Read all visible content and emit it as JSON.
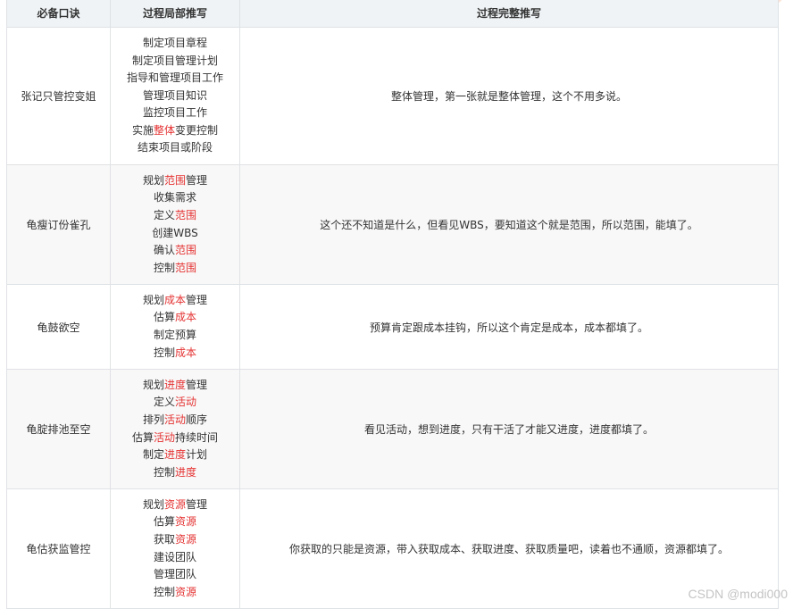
{
  "header": {
    "col1": "必备口诀",
    "col2": "过程局部推写",
    "col3": "过程完整推写"
  },
  "rows": [
    {
      "mnemonic": "张记只管控变姐",
      "processes": [
        [
          "制定项目章程"
        ],
        [
          "制定项目管理计划"
        ],
        [
          "指导和管理项目工作"
        ],
        [
          "管理项目知识"
        ],
        [
          "监控项目工作"
        ],
        [
          "实施",
          "整体",
          "变更控制"
        ],
        [
          "结束项目或阶段"
        ]
      ],
      "explanation": "整体管理，第一张就是整体管理，这个不用多说。"
    },
    {
      "mnemonic": "龟瘦订份雀孔",
      "processes": [
        [
          "规划",
          "范围",
          "管理"
        ],
        [
          "收集需求"
        ],
        [
          "定义",
          "范围",
          ""
        ],
        [
          "创建WBS"
        ],
        [
          "确认",
          "范围",
          ""
        ],
        [
          "控制",
          "范围",
          ""
        ]
      ],
      "explanation": "这个还不知道是什么，但看见WBS，要知道这个就是范围，所以范围，能填了。"
    },
    {
      "mnemonic": "龟鼓欲空",
      "processes": [
        [
          "规划",
          "成本",
          "管理"
        ],
        [
          "估算",
          "成本",
          ""
        ],
        [
          "制定预算"
        ],
        [
          "控制",
          "成本",
          ""
        ]
      ],
      "explanation": "预算肯定跟成本挂钩，所以这个肯定是成本，成本都填了。"
    },
    {
      "mnemonic": "龟腚排池至空",
      "processes": [
        [
          "规划",
          "进度",
          "管理"
        ],
        [
          "定义",
          "活动",
          ""
        ],
        [
          "排列",
          "活动",
          "顺序"
        ],
        [
          "估算",
          "活动",
          "持续时间"
        ],
        [
          "制定",
          "进度",
          "计划"
        ],
        [
          "控制",
          "进度",
          ""
        ]
      ],
      "explanation": "看见活动，想到进度，只有干活了才能又进度，进度都填了。"
    },
    {
      "mnemonic": "龟估获监管控",
      "processes": [
        [
          "规划",
          "资源",
          "管理"
        ],
        [
          "估算",
          "资源",
          ""
        ],
        [
          "获取",
          "资源",
          ""
        ],
        [
          "建设团队"
        ],
        [
          "管理团队"
        ],
        [
          "控制",
          "资源",
          ""
        ]
      ],
      "explanation": "你获取的只能是资源，带入获取成本、获取进度、获取质量吧，读着也不通顺，资源都填了。"
    }
  ],
  "watermark": "CSDN @modi000",
  "colors": {
    "highlight": "#e53333",
    "header_bg": "#eff3f5",
    "alt_row_bg": "#f8f8f8",
    "border": "#dfe2e5"
  }
}
